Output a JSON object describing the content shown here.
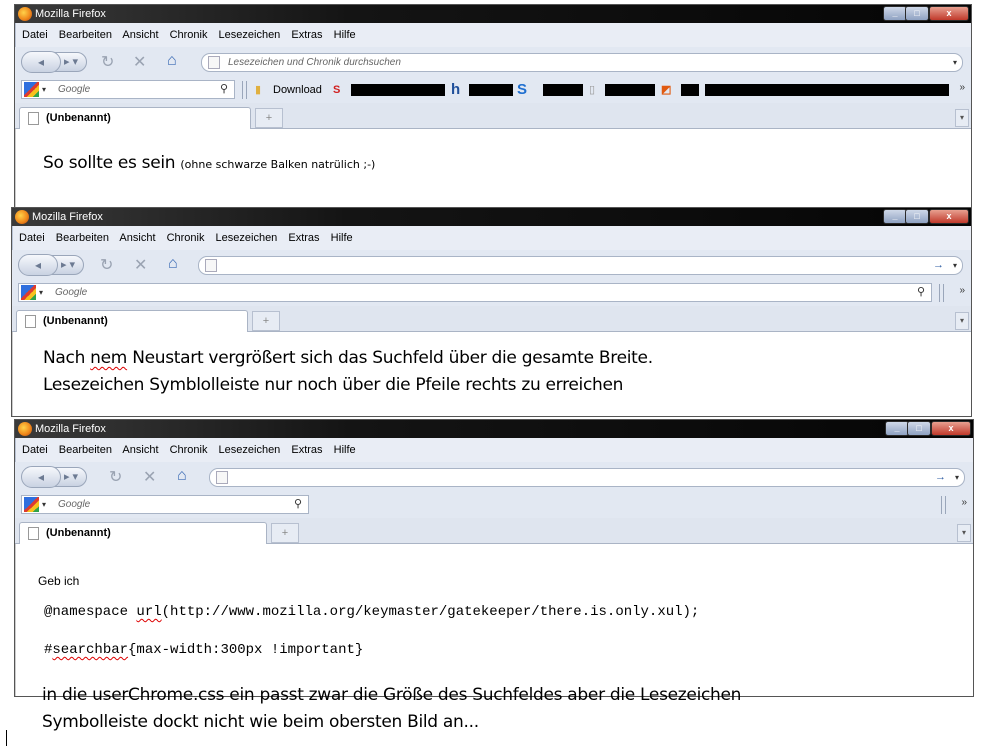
{
  "window_title": "Mozilla Firefox",
  "menu": [
    "Datei",
    "Bearbeiten",
    "Ansicht",
    "Chronik",
    "Lesezeichen",
    "Extras",
    "Hilfe"
  ],
  "url_placeholder": "Lesezeichen und Chronik durchsuchen",
  "search_placeholder": "Google",
  "tab_label": "(Unbenannt)",
  "bookmark_download": "Download",
  "panel1": {
    "caption": "So sollte es sein",
    "caption_note": "(ohne schwarze Balken natrülich ;-)"
  },
  "panel2": {
    "line1_a": "Nach",
    "line1_b": "nem",
    "line1_c": "Neustart vergrößert sich das Suchfeld über die gesamte Breite.",
    "line2": "Lesezeichen Symblolleiste nur noch über die Pfeile rechts zu erreichen"
  },
  "panel3": {
    "intro": "Geb ich",
    "code1_a": "@namespace",
    "code1_b": "url",
    "code1_c": "(http://www.mozilla.org/keymaster/gatekeeper/there.is.only.xul);",
    "code2_a": "#",
    "code2_b": "searchbar",
    "code2_c": "{max-width:300px !important}",
    "outro1": "in die userChrome.css ein passt zwar die Größe des Suchfeldes aber die Lesezeichen",
    "outro2": "Symbolleiste dockt nicht wie beim obersten Bild an..."
  },
  "colors": {
    "titlebar": "#111111",
    "toolbar": "#e2e8f2",
    "accent": "#2a5aa0"
  }
}
